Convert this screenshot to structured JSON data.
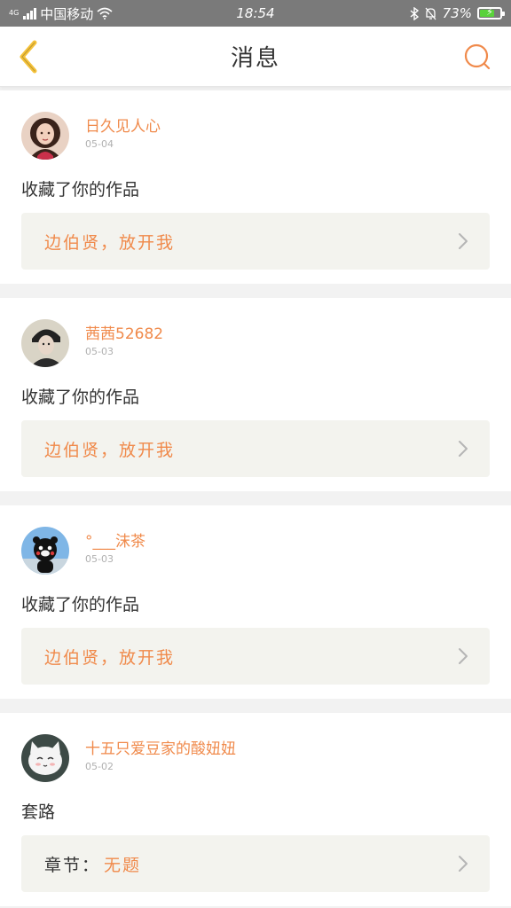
{
  "status_bar": {
    "network_tag": "4G",
    "carrier": "中国移动",
    "time": "18:54",
    "battery": "73%",
    "battery_level": 0.73
  },
  "header": {
    "title": "消息",
    "back_icon": "chevron-left-icon",
    "search_icon": "search-icon"
  },
  "colors": {
    "accent": "#f08a4b",
    "back_arrow": "#f5c23a",
    "card_link_bg": "#f3f3ee"
  },
  "messages": [
    {
      "username": "日久见人心",
      "date": "05-04",
      "action": "收藏了你的作品",
      "work": "边伯贤，放开我"
    },
    {
      "username": "茜茜52682",
      "date": "05-03",
      "action": "收藏了你的作品",
      "work": "边伯贤，放开我"
    },
    {
      "username": "°___沫茶",
      "date": "05-03",
      "action": "收藏了你的作品",
      "work": "边伯贤，放开我"
    },
    {
      "username": "十五只爱豆家的酸妞妞",
      "date": "05-02",
      "action": "套路",
      "work_prefix": "章节：",
      "work": "无题"
    }
  ]
}
